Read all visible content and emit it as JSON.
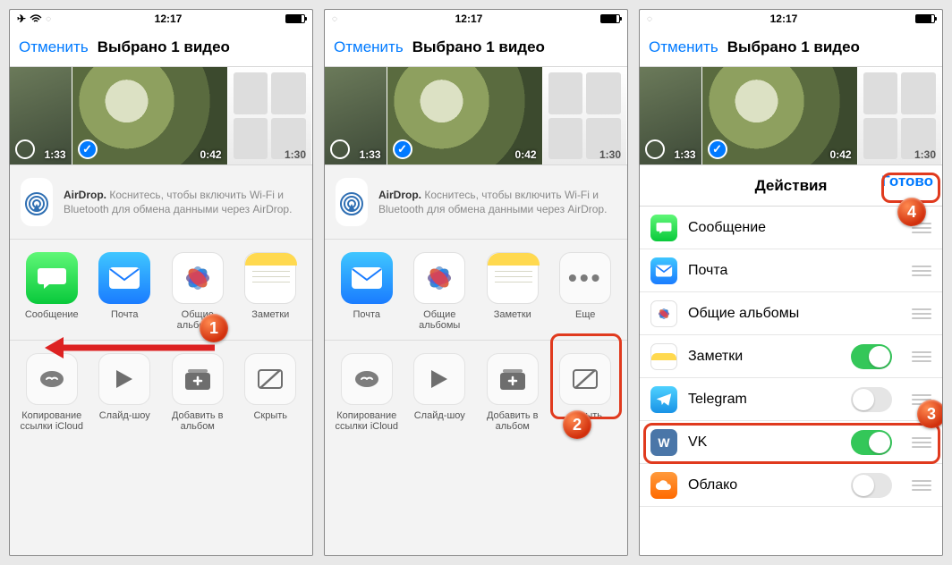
{
  "status": {
    "time": "12:17"
  },
  "nav": {
    "cancel": "Отменить",
    "title": "Выбрано 1 видео",
    "done": "Готово"
  },
  "thumbs": {
    "d1": "1:33",
    "d2": "0:42",
    "d3": "1:30"
  },
  "airdrop": {
    "title": "AirDrop.",
    "text": "Коснитесь, чтобы включить Wi-Fi и Bluetooth для обмена данными через AirDrop."
  },
  "apps": {
    "messages": "Сообщение",
    "mail": "Почта",
    "shared_albums": "Общие альбомы",
    "notes": "Заметки",
    "more": "Еще"
  },
  "actions": {
    "copy_link": "Копирование ссылки iCloud",
    "slideshow": "Слайд-шоу",
    "add_album": "Добавить в альбом",
    "hide": "Скрыть"
  },
  "manage": {
    "title": "Действия",
    "items": {
      "messages": "Сообщение",
      "mail": "Почта",
      "shared_albums": "Общие альбомы",
      "notes": "Заметки",
      "telegram": "Telegram",
      "vk": "VK",
      "cloud": "Облако"
    }
  },
  "callouts": {
    "c1": "1",
    "c2": "2",
    "c3": "3",
    "c4": "4"
  }
}
